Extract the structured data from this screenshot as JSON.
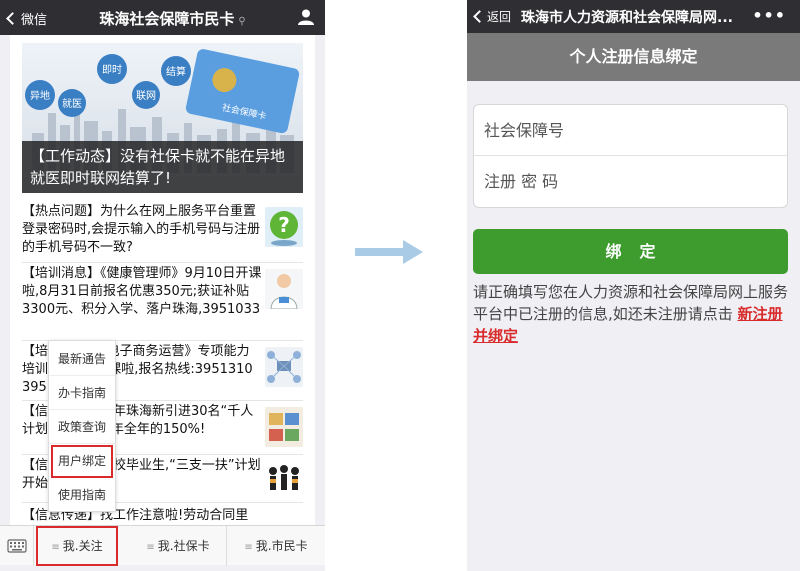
{
  "left": {
    "header": {
      "back_label": "微信",
      "title": "珠海社会保障市民卡"
    },
    "banner": {
      "bubbles": [
        "异地",
        "就医",
        "即时",
        "联网",
        "结算"
      ],
      "card_text": "社会保障卡",
      "caption": "【工作动态】没有社保卡就不能在异地就医即时联网结算了!"
    },
    "news": [
      {
        "text": "【热点问题】为什么在网上服务平台重置登录密码时,会提示输入的手机号码与注册的手机号码不一致?"
      },
      {
        "text": "【培训消息】《健康管理师》9月10日开课啦,8月31日前报名优惠350元;获证补贴3300元、积分入学、落户珠海,3951033"
      },
      {
        "text": "【培训消息】《电子商务运营》专项能力培训9月中旬开课啦,报名热线:3951310 3951033"
      },
      {
        "text": "【信息传递】今年珠海新引进30名“千人计划”专家,超去年全年的150%!"
      },
      {
        "text": "【信息传递】高校毕业生,“三支一扶”计划开始接收!"
      },
      {
        "text": "【信息传递】找工作注意啦!劳动合同里"
      }
    ],
    "popup_menu": [
      "最新通告",
      "办卡指南",
      "政策查询",
      "用户绑定",
      "使用指南"
    ],
    "tabs": [
      "我.关注",
      "我.社保卡",
      "我.市民卡"
    ]
  },
  "right": {
    "header": {
      "back_label": "返回",
      "title": "珠海市人力资源和社会保障局网...",
      "more": "•••"
    },
    "page_title": "个人注册信息绑定",
    "form": {
      "id_placeholder": "社会保障号",
      "pwd_placeholder": "注册 密 码"
    },
    "bind_button": "绑定",
    "hint_text": "请正确填写您在人力资源和社会保障局网上服务平台中已注册的信息,如还未注册请点击",
    "register_link": "新注册并绑定"
  },
  "colors": {
    "header_bg": "#2f2f33",
    "bind_green": "#3e9b2e",
    "highlight_red": "#d92b2b",
    "subheader_gray": "#7a7a7a"
  }
}
